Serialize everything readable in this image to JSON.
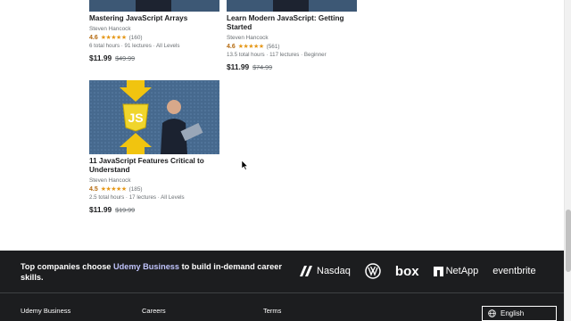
{
  "courses": [
    {
      "title": "Mastering JavaScript Arrays",
      "author": "Steven Hancock",
      "rating": "4.6",
      "stars": "★★★★★",
      "count": "(160)",
      "meta": "6 total hours · 91 lectures · All Levels",
      "price": "$11.99",
      "original_price": "$49.99"
    },
    {
      "title": "Learn Modern JavaScript: Getting Started",
      "author": "Steven Hancock",
      "rating": "4.6",
      "stars": "★★★★★",
      "count": "(561)",
      "meta": "13.5 total hours · 117 lectures · Beginner",
      "price": "$11.99",
      "original_price": "$74.99"
    },
    {
      "title": "11 JavaScript Features Critical to Understand",
      "author": "Steven Hancock",
      "rating": "4.5",
      "stars": "★★★★★",
      "count": "(185)",
      "meta": "2.5 total hours · 17 lectures · All Levels",
      "price": "$11.99",
      "original_price": "$19.99",
      "thumbnail_badge": "JS"
    }
  ],
  "footer": {
    "promo_prefix": "Top companies choose ",
    "promo_brand": "Udemy Business",
    "promo_suffix": " to build in-demand career skills.",
    "logos": [
      "Nasdaq",
      "box",
      "NetApp",
      "eventbrite"
    ],
    "links": [
      "Udemy Business",
      "Careers",
      "Terms"
    ],
    "language": "English"
  },
  "colors": {
    "footer_bg": "#1c1d1f",
    "brand_link": "#c0c4fc",
    "rating": "#b4690e",
    "star": "#e59819"
  }
}
